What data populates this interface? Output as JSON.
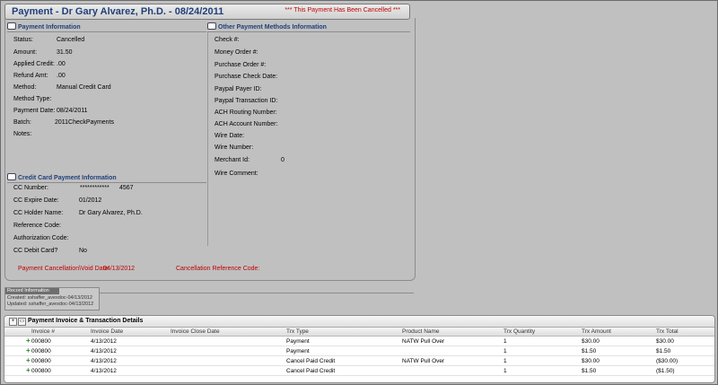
{
  "header": {
    "title": "Payment - Dr Gary Alvarez, Ph.D. - 08/24/2011",
    "cancel_notice": "*** This Payment Has Been Cancelled ***"
  },
  "payment_info": {
    "heading": "Payment Information",
    "fields": [
      {
        "label": "Status:",
        "value": "Cancelled"
      },
      {
        "label": "Amount:",
        "value": "31.50"
      },
      {
        "label": "Applied Credit:",
        "value": ".00"
      },
      {
        "label": "Refund Amt:",
        "value": ".00"
      },
      {
        "label": "Method:",
        "value": "Manual Credit Card"
      },
      {
        "label": "Method Type:",
        "value": ""
      },
      {
        "label": "Payment Date:",
        "value": "08/24/2011"
      },
      {
        "label": "Batch:",
        "value": "2011CheckPayments"
      },
      {
        "label": "Notes:",
        "value": ""
      }
    ]
  },
  "other_methods": {
    "heading": "Other Payment Methods Information",
    "fields": [
      {
        "label": "Check #:",
        "value": ""
      },
      {
        "label": "Money Order #:",
        "value": ""
      },
      {
        "label": "Purchase Order #:",
        "value": ""
      },
      {
        "label": "Purchase Check Date:",
        "value": ""
      },
      {
        "label": "Paypal Payer ID:",
        "value": ""
      },
      {
        "label": "Paypal Transaction ID:",
        "value": ""
      },
      {
        "label": "ACH Routing Number:",
        "value": ""
      },
      {
        "label": "ACH Account Number:",
        "value": ""
      },
      {
        "label": "Wire Date:",
        "value": ""
      },
      {
        "label": "Wire Number:",
        "value": ""
      },
      {
        "label": "Merchant Id:",
        "value": "0"
      },
      {
        "label": "Wire Comment:",
        "value": ""
      }
    ]
  },
  "cc_info": {
    "heading": "Credit Card Payment Information",
    "fields": [
      {
        "label": "CC Number:",
        "value": "************",
        "value2": "4567"
      },
      {
        "label": "CC Expire Date:",
        "value": "01/2012"
      },
      {
        "label": "CC Holder Name:",
        "value": "Dr Gary Alvarez, Ph.D."
      },
      {
        "label": "Reference Code:",
        "value": ""
      },
      {
        "label": "Authorization Code:",
        "value": ""
      },
      {
        "label": "CC Debit Card?",
        "value": "No"
      }
    ]
  },
  "cancellation": {
    "void_label": "Payment Cancellation\\Void Date:",
    "void_date": "04/13/2012",
    "reference_label": "Cancellation Reference Code:"
  },
  "record_info": {
    "heading": "Record Information",
    "created": "Created: sshaffer_avexdoc-04/13/2012",
    "updated": "Updated: sshaffer_avexdoc-04/13/2012"
  },
  "grid": {
    "title": "Payment Invoice & Transaction Details",
    "columns": [
      "Invoice #",
      "Invoice Date",
      "Invoice Close Date",
      "Trx Type",
      "Product Name",
      "Trx Quantity",
      "Trx Amount",
      "Trx Total"
    ],
    "rows": [
      [
        "000800",
        "4/13/2012",
        "",
        "Payment",
        "NATW Pull Over",
        "1",
        "$30.00",
        "$30.00"
      ],
      [
        "000800",
        "4/13/2012",
        "",
        "Payment",
        "",
        "1",
        "$1.50",
        "$1.50"
      ],
      [
        "000800",
        "4/13/2012",
        "",
        "Cancel Paid Credit",
        "NATW Pull Over",
        "1",
        "$30.00",
        "($30.00)"
      ],
      [
        "000800",
        "4/13/2012",
        "",
        "Cancel Paid Credit",
        "",
        "1",
        "$1.50",
        "($1.50)"
      ]
    ]
  }
}
